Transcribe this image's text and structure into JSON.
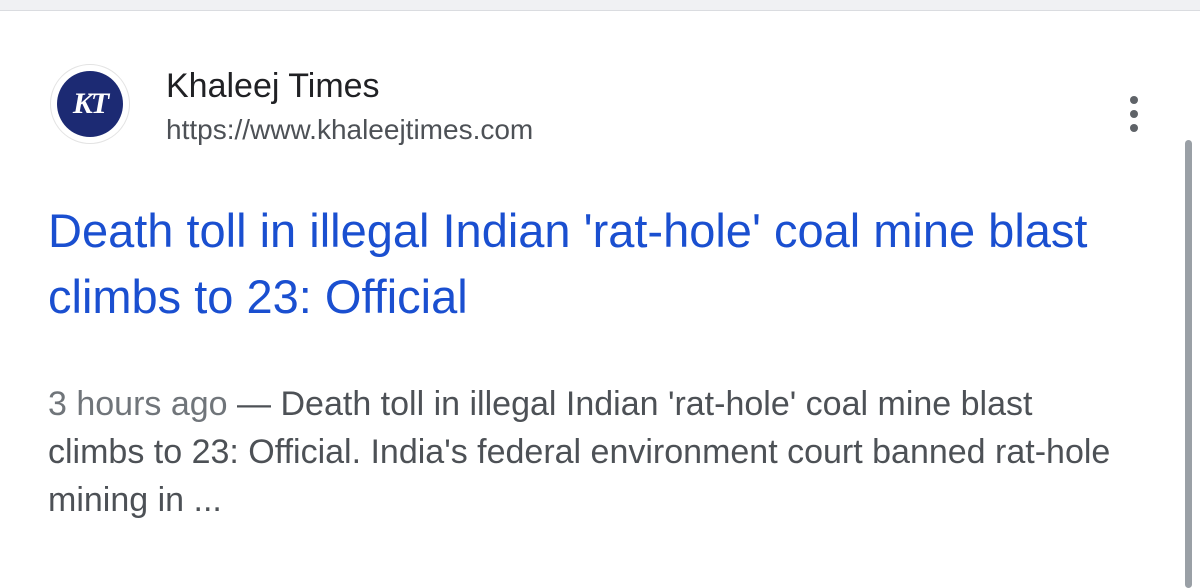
{
  "result": {
    "favicon_text": "KT",
    "site_name": "Khaleej Times",
    "site_url": "https://www.khaleejtimes.com",
    "title": "Death toll in illegal Indian 'rat-hole' coal mine blast climbs to 23: Official",
    "snippet_date": "3 hours ago",
    "snippet_separator": " — ",
    "snippet_text": "Death toll in illegal Indian 'rat-hole' coal mine blast climbs to 23: Official. India's federal environment court banned rat-hole mining in ..."
  },
  "icons": {
    "more_options": "more-vert-icon",
    "favicon": "khaleej-times-logo-icon"
  },
  "colors": {
    "title_link": "#1a4fd0",
    "site_name": "#202124",
    "url": "#4d5156",
    "snippet": "#4d5156",
    "favicon_bg": "#1c2a73"
  }
}
